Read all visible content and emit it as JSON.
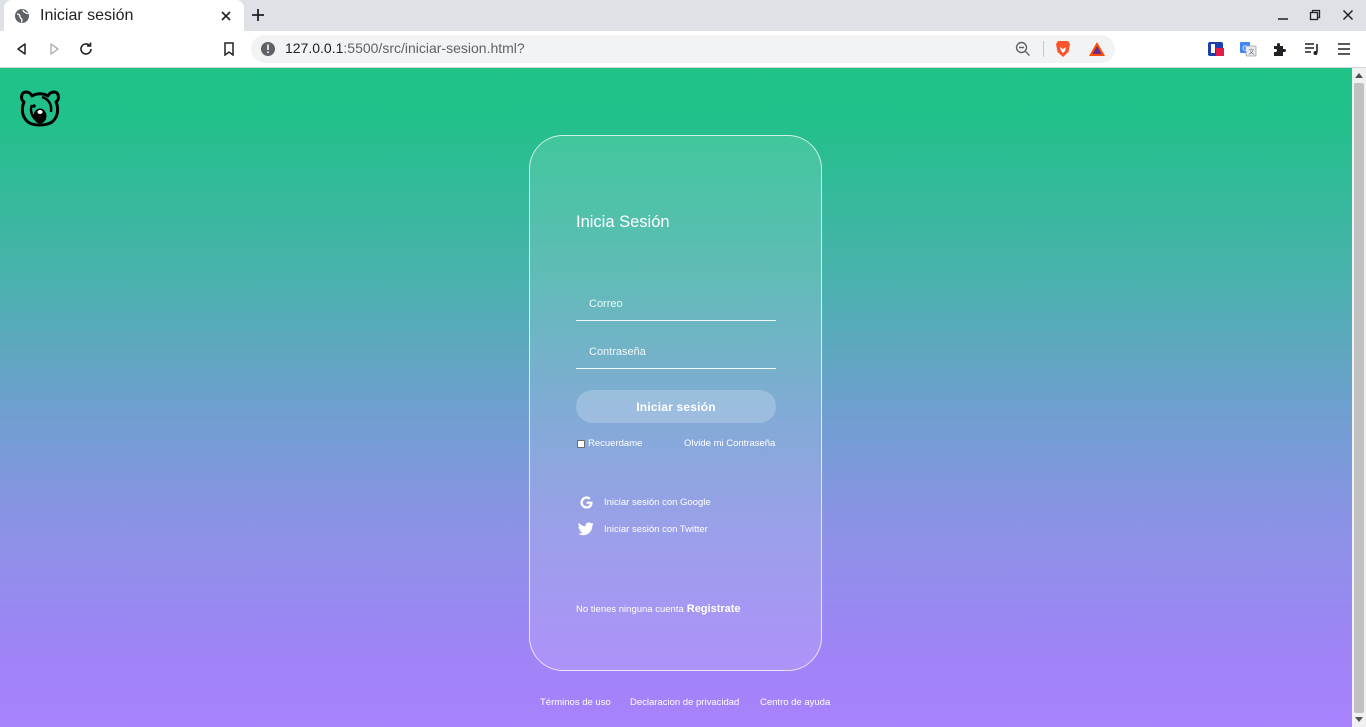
{
  "browser": {
    "tab_title": "Iniciar sesión",
    "url_host": "127.0.0.1",
    "url_path": ":5500/src/iniciar-sesion.html?"
  },
  "login": {
    "title": "Inicia Sesión",
    "email_placeholder": "Correo",
    "password_placeholder": "Contraseña",
    "submit_label": "Iniciar sesión",
    "remember_label": "Recuerdame",
    "remember_checked": false,
    "forgot_label": "Olvide mi Contraseña",
    "google_label": "Iniciar sesión con Google",
    "twitter_label": "Iniciar sesión con Twitter",
    "signup_question": "No tienes ninguna cuenta",
    "signup_link": "Registrate"
  },
  "footer": {
    "terms": "Términos de uso",
    "privacy": "Declaracion de privacidad",
    "help": "Centro de ayuda"
  },
  "colors": {
    "gradient_top": "#1fc388",
    "gradient_bottom": "#a783fc",
    "accent_white": "#ffffff"
  },
  "icons": {
    "logo": "bear-logo-icon",
    "google": "google-icon",
    "twitter": "twitter-icon"
  }
}
